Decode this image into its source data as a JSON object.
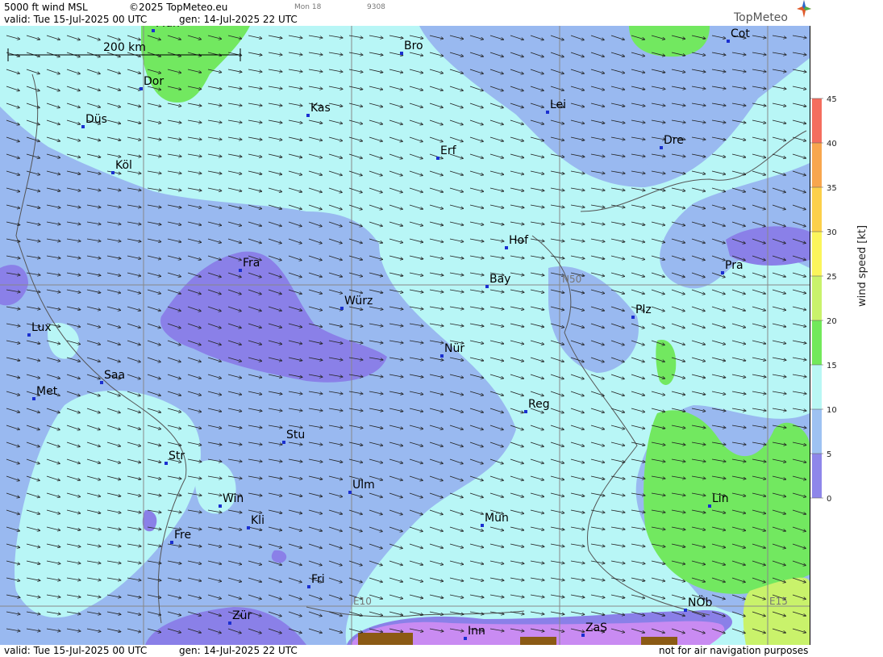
{
  "header": {
    "product": "5000 ft wind MSL",
    "copyright": "©2025 TopMeteo.eu",
    "weekday_small": "Mon 18",
    "code_small": "9308",
    "valid": "valid:  Tue  15-Jul-2025  00 UTC",
    "generated": "gen: 14-Jul-2025 22 UTC",
    "logo": "TopMeteo"
  },
  "footer": {
    "valid": "valid:  Tue  15-Jul-2025  00 UTC",
    "generated": "gen: 14-Jul-2025 22 UTC",
    "disclaimer": "not for air navigation purposes"
  },
  "scale_bar": {
    "label": "200 km"
  },
  "grid_labels": {
    "n50": "N50",
    "e10": "E10",
    "e15": "E15"
  },
  "legend": {
    "title": "wind speed [kt]",
    "ticks": [
      "45",
      "40",
      "35",
      "30",
      "25",
      "20",
      "15",
      "10",
      "5",
      "0"
    ],
    "colors": [
      "#f46d5e",
      "#f8a64e",
      "#fcd04a",
      "#fbf55b",
      "#c9f26b",
      "#72e95a",
      "#b9f7f4",
      "#9ec2f2",
      "#8e86ea",
      "#cf84f3"
    ]
  },
  "colors": {
    "calm_violet": "#c98bf2",
    "light_wind": "#8a80e8",
    "moderate": "#99b9f0",
    "fresh": "#b8f6f6",
    "strong": "#72e860",
    "terrain": "#8b5a14"
  },
  "cities": [
    {
      "label": "Mün"
    },
    {
      "label": "Bro"
    },
    {
      "label": "Cot"
    },
    {
      "label": "Dor"
    },
    {
      "label": "Kas"
    },
    {
      "label": "Lei"
    },
    {
      "label": "Düs"
    },
    {
      "label": "Erf"
    },
    {
      "label": "Dre"
    },
    {
      "label": "Köl"
    },
    {
      "label": "Hof"
    },
    {
      "label": "Fra"
    },
    {
      "label": "Pra"
    },
    {
      "label": "Bay"
    },
    {
      "label": "Würz"
    },
    {
      "label": "Plz"
    },
    {
      "label": "Lux"
    },
    {
      "label": "Nür"
    },
    {
      "label": "Saa"
    },
    {
      "label": "Met"
    },
    {
      "label": "Reg"
    },
    {
      "label": "Stu"
    },
    {
      "label": "Str"
    },
    {
      "label": "Ulm"
    },
    {
      "label": "Win"
    },
    {
      "label": "Lin"
    },
    {
      "label": "Kli"
    },
    {
      "label": "Mün"
    },
    {
      "label": "Fre"
    },
    {
      "label": "Fri"
    },
    {
      "label": "NÖb"
    },
    {
      "label": "Zür"
    },
    {
      "label": "ZaS"
    },
    {
      "label": "Inn"
    }
  ]
}
